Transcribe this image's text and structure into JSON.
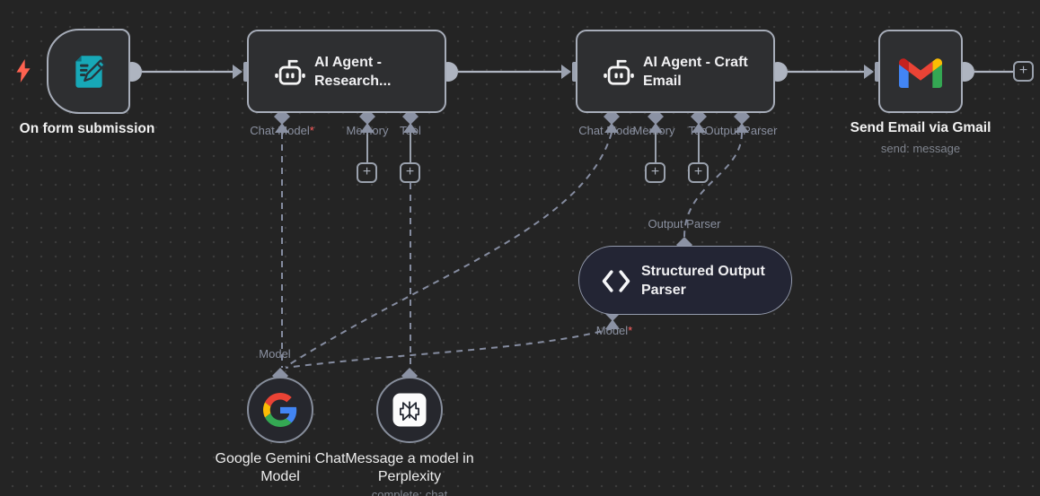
{
  "app": {
    "name": "workflow-canvas"
  },
  "misc": {
    "plus": "+",
    "required_marker": "*"
  },
  "colors": {
    "canvas_bg": "#242424",
    "node_fill": "#2e2f31",
    "node_border": "#a7adb9",
    "parser_fill": "#232534",
    "connection": "#aeb4c0",
    "dashed_connection": "#858ca0",
    "connector_diamond": "#8b92a4",
    "label_gray": "#8a90a0",
    "required_red": "#ff5c5c",
    "trigger_bolt": "#ff6250",
    "form_icon_teal": "#17a8b7",
    "google_blue": "#4285F4",
    "google_red": "#EA4335",
    "google_yellow": "#FBBC05",
    "google_green": "#34A853"
  },
  "nodes": {
    "form_trigger": {
      "label": "On form submission"
    },
    "agent_research": {
      "title_line1": "AI Agent -",
      "title_line2": "Research...",
      "connectors": [
        {
          "label": "Chat Model",
          "required": true
        },
        {
          "label": "Memory",
          "required": false
        },
        {
          "label": "Tool",
          "required": false
        }
      ]
    },
    "agent_craft": {
      "title_line1": "AI Agent - Craft",
      "title_line2": "Email",
      "connectors": [
        {
          "label": "Chat Mode",
          "required": false
        },
        {
          "label": "Memory",
          "required": false
        },
        {
          "label": "Too",
          "required": false
        },
        {
          "label": "Output Parser",
          "required": false
        }
      ]
    },
    "gmail": {
      "label": "Send Email via Gmail",
      "subtitle": "send: message"
    },
    "output_parser": {
      "title_line1": "Structured Output",
      "title_line2": "Parser",
      "top_connector_label": "Output Parser",
      "bottom_connector_label": "Model",
      "bottom_connector_required": true
    },
    "gemini": {
      "connector_label": "Model",
      "label_line1": "Google Gemini Chat",
      "label_line2": "Model"
    },
    "perplexity": {
      "label_line1": "Message a model in",
      "label_line2": "Perplexity",
      "subtitle": "complete: chat"
    }
  }
}
